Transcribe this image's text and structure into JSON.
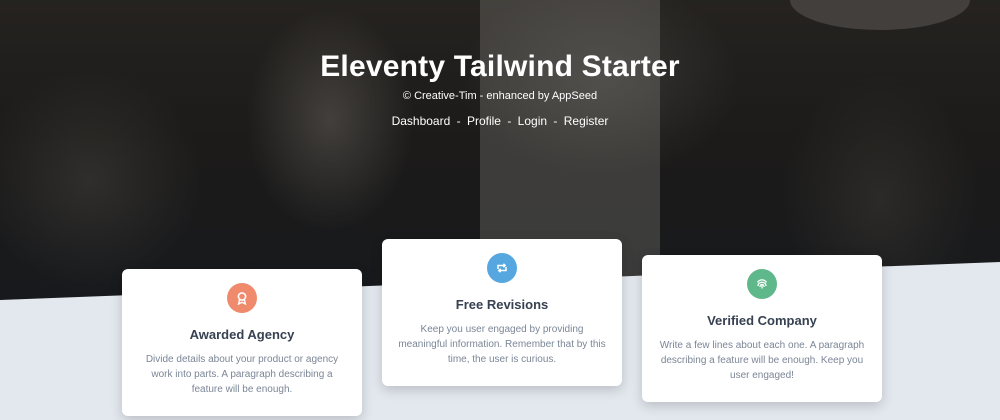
{
  "hero": {
    "title": "Eleventy Tailwind Starter",
    "credit": "© Creative-Tim - enhanced by AppSeed",
    "nav": [
      {
        "label": "Dashboard"
      },
      {
        "label": "Profile"
      },
      {
        "label": "Login"
      },
      {
        "label": "Register"
      }
    ],
    "nav_separator": "-"
  },
  "features": [
    {
      "title": "Awarded Agency",
      "text": "Divide details about your product or agency work into parts. A paragraph describing a feature will be enough.",
      "icon": "award-icon",
      "color": "#f08a6c"
    },
    {
      "title": "Free Revisions",
      "text": "Keep you user engaged by providing meaningful information. Remember that by this time, the user is curious.",
      "icon": "retweet-icon",
      "color": "#56a7e0"
    },
    {
      "title": "Verified Company",
      "text": "Write a few lines about each one. A paragraph describing a feature will be enough. Keep you user engaged!",
      "icon": "fingerprint-icon",
      "color": "#5fb88a"
    }
  ]
}
